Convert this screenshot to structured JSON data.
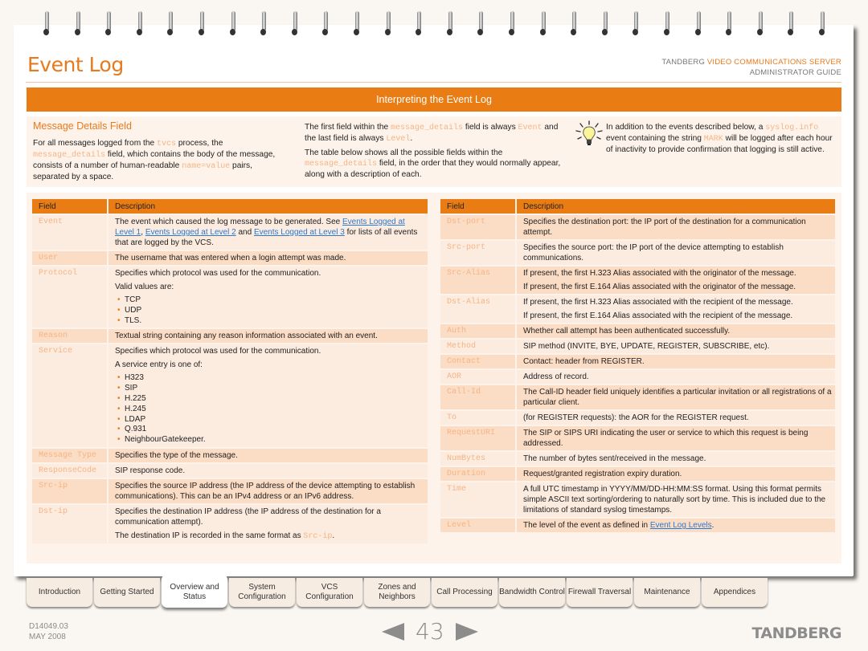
{
  "header": {
    "title": "Event Log",
    "brand_prefix": "TANDBERG",
    "brand_product": "VIDEO COMMUNICATIONS SERVER",
    "guide": "ADMINISTRATOR GUIDE"
  },
  "section_title": "Interpreting the Event Log",
  "intro": {
    "heading": "Message Details Field",
    "col1": {
      "t1": "For all messages logged from the ",
      "c1": "tvcs",
      "t2": " process, the ",
      "c2": "message_details",
      "t3": " field, which contains the body of the message, consists of a number of human-readable ",
      "c3": "name=value",
      "t4": " pairs, separated by a space."
    },
    "col2": {
      "p1_t1": "The first field within the ",
      "p1_c1": "message_details",
      "p1_t2": " field is always ",
      "p1_c2": "Event",
      "p1_t3": " and the last field is always ",
      "p1_c3": "Level",
      "p1_t4": ".",
      "p2_t1": "The table below shows all the possible fields within the ",
      "p2_c1": "message_details",
      "p2_t2": " field, in the order that they would normally appear, along with a description of each."
    },
    "tip": {
      "icon": "lightbulb-icon",
      "t1": "In addition to the events described below, a ",
      "c1": "syslog.info",
      "t2": " event containing the string ",
      "c2": "MARK",
      "t3": " will be logged after each hour of inactivity to provide confirmation that logging is still active."
    }
  },
  "table_headers": {
    "field": "Field",
    "description": "Description"
  },
  "left_table": {
    "event": {
      "field": "Event",
      "t1": "The event which caused the log message to be generated. See ",
      "link1": "Events Logged at Level 1",
      "t2": ", ",
      "link2": "Events Logged at Level 2",
      "t3": " and ",
      "link3": "Events Logged at Level 3",
      "t4": " for lists of all events that are logged by the VCS."
    },
    "user": {
      "field": "User",
      "desc": "The username that was entered when a login attempt was made."
    },
    "protocol": {
      "field": "Protocol",
      "desc": "Specifies which protocol was used for the communication.",
      "values_intro": "Valid values are:",
      "values": [
        "TCP",
        "UDP",
        "TLS."
      ]
    },
    "reason": {
      "field": "Reason",
      "desc": "Textual string containing any reason information associated with an event."
    },
    "service": {
      "field": "Service",
      "desc": "Specifies which protocol was used for the communication.",
      "values_intro": "A service entry is one of:",
      "values": [
        "H323",
        "SIP",
        "H.225",
        "H.245",
        "LDAP",
        "Q.931",
        "NeighbourGatekeeper."
      ]
    },
    "message_type": {
      "field": "Message Type",
      "desc": "Specifies the type of the message."
    },
    "response_code": {
      "field": "ResponseCode",
      "desc": "SIP response code."
    },
    "src_ip": {
      "field": "Src-ip",
      "desc": "Specifies the source IP address (the IP address of the device attempting to establish communications). This can be an IPv4 address or an IPv6 address."
    },
    "dst_ip": {
      "field": "Dst-ip",
      "desc": "Specifies the destination IP address (the IP address of the destination for a communication attempt).",
      "note_t1": "The destination IP is recorded in the same format as ",
      "note_code": "Src-ip",
      "note_t2": "."
    }
  },
  "right_table": {
    "dst_port": {
      "field": "Dst-port",
      "desc": "Specifies the destination port: the IP port of the destination for a communication attempt."
    },
    "src_port": {
      "field": "Src-port",
      "desc": "Specifies the source port: the IP port of the device attempting to establish communications."
    },
    "src_alias": {
      "field": "Src-Alias",
      "desc1": "If present, the first H.323 Alias associated with the originator of the message.",
      "desc2": "If present, the first E.164 Alias associated with the originator of the message."
    },
    "dst_alias": {
      "field": "Dst-Alias",
      "desc1": "If present, the first H.323 Alias associated with the recipient of the message.",
      "desc2": "If present, the first E.164 Alias associated with the recipient of the message."
    },
    "auth": {
      "field": "Auth",
      "desc": "Whether call attempt has been authenticated successfully."
    },
    "method": {
      "field": "Method",
      "desc": "SIP method (INVITE, BYE, UPDATE, REGISTER, SUBSCRIBE, etc)."
    },
    "contact": {
      "field": "Contact",
      "desc": "Contact: header from REGISTER."
    },
    "aor": {
      "field": "AOR",
      "desc": "Address of record."
    },
    "call_id": {
      "field": "Call-Id",
      "desc": "The Call-ID header field uniquely identifies a particular invitation or all registrations of a particular client."
    },
    "to": {
      "field": "To",
      "desc": "(for REGISTER requests): the AOR for the REGISTER request."
    },
    "request_uri": {
      "field": "RequestURI",
      "desc": "The SIP or SIPS URI indicating the user or service to which this request is being addressed."
    },
    "num_bytes": {
      "field": "NumBytes",
      "desc": "The number of bytes sent/received in the message."
    },
    "duration": {
      "field": "Duration",
      "desc": "Request/granted registration expiry duration."
    },
    "time": {
      "field": "Time",
      "desc": "A full UTC timestamp in YYYY/MM/DD-HH:MM:SS format. Using this format permits simple ASCII text sorting/ordering to naturally sort by time. This is included due to the limitations of standard syslog timestamps."
    },
    "level": {
      "field": "Level",
      "t1": "The level of the event as defined in ",
      "link": "Event Log Levels",
      "t2": "."
    }
  },
  "nav_tabs": [
    {
      "label": "Introduction"
    },
    {
      "label": "Getting Started"
    },
    {
      "label": "Overview and Status",
      "active": true
    },
    {
      "label": "System Configuration"
    },
    {
      "label": "VCS Configuration"
    },
    {
      "label": "Zones and Neighbors"
    },
    {
      "label": "Call Processing"
    },
    {
      "label": "Bandwidth Control"
    },
    {
      "label": "Firewall Traversal"
    },
    {
      "label": "Maintenance"
    },
    {
      "label": "Appendices"
    }
  ],
  "footer": {
    "doc_id": "D14049.03",
    "date": "MAY 2008",
    "page_number": "43",
    "logo": "TANDBERG"
  },
  "colors": {
    "accent": "#ea7c14",
    "row_dark": "#fbdcc4",
    "row_light": "#fcebdf",
    "code_text": "#f5b585",
    "link": "#2a7ad1"
  }
}
